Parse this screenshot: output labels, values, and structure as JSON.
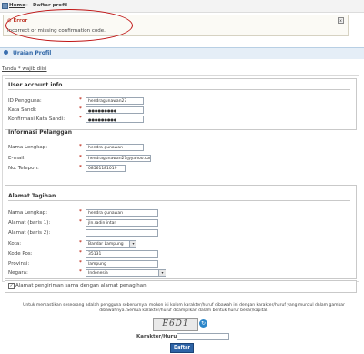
{
  "breadcrumb": {
    "home": "Home",
    "separator": "»",
    "current": "Daftar profil"
  },
  "error": {
    "title": "Error",
    "message": "Incorrect or missing confirmation code.",
    "close": "x"
  },
  "section": {
    "title": "Uraian Profil",
    "required_note": "Tanda * wajib diisi"
  },
  "account": {
    "title": "User account info",
    "fields": [
      {
        "label": "ID Pengguna:",
        "value": "hendragunawan27"
      },
      {
        "label": "Kata Sandi:",
        "value": "●●●●●●●●●"
      },
      {
        "label": "Konfirmasi Kata Sandi:",
        "value": "●●●●●●●●●"
      }
    ]
  },
  "customer": {
    "title": "Informasi Pelanggan",
    "fields": [
      {
        "label": "Nama Lengkap:",
        "value": "hendra gunawan"
      },
      {
        "label": "E-mail:",
        "value": "hendragunawan27@yahoo.com"
      },
      {
        "label": "No. Telepon:",
        "value": "08561181019"
      }
    ]
  },
  "billing": {
    "title": "Alamat Tagihan",
    "fields": [
      {
        "label": "Nama Lengkap:",
        "value": "hendra gunawan"
      },
      {
        "label": "Alamat (baris 1):",
        "value": "jln.radin intan"
      },
      {
        "label": "Alamat (baris 2):",
        "value": ""
      },
      {
        "label": "Kota:",
        "value": "Bandar Lampung"
      },
      {
        "label": "Kode Pos:",
        "value": "35131"
      },
      {
        "label": "Provinsi:",
        "value": "lampung"
      },
      {
        "label": "Negara:",
        "value": "Indonesia"
      }
    ],
    "same_address_label": "Alamat pengiriman sama dengan alamat penagihan",
    "same_address_checked": true
  },
  "captcha": {
    "instructions": "Untuk memastikan seseorang adalah pengguna sebenarnya, mohon isi kolom karakter/huruf dibawah ini dengan karakter/huruf yang muncul dalam gambar dibawahnya. Semua karakter/huruf ditampilkan dalam bentuk huruf besar/kapital.",
    "image_text": "E6D1",
    "label": "Karakter/Huruf:",
    "value": ""
  },
  "submit_label": "Daftar"
}
